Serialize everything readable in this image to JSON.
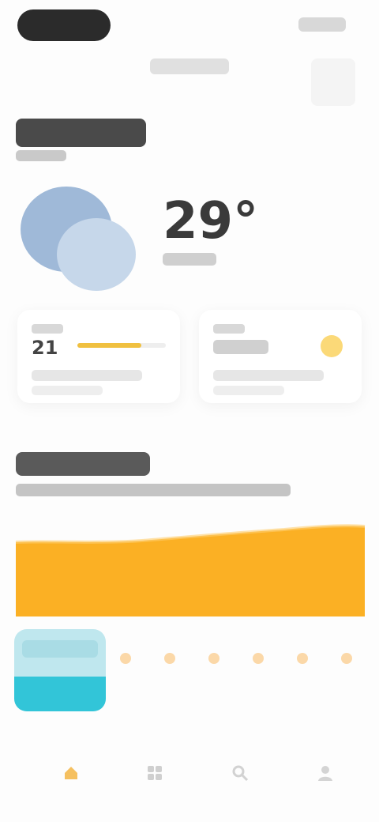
{
  "status_bar": {
    "right_text": ""
  },
  "header": {
    "center_text": "",
    "right_faint": ""
  },
  "location": {
    "title": "",
    "subtitle": ""
  },
  "current": {
    "temperature": "29°",
    "condition": "",
    "icon": "partly-cloudy-icon"
  },
  "stats": [
    {
      "label": "",
      "value": "21",
      "level": 0.72,
      "description": ""
    },
    {
      "label": "",
      "value": "",
      "description": "",
      "icon": "sun-icon"
    }
  ],
  "forecast": {
    "title": "",
    "subtitle": "",
    "days": [
      {
        "name": "",
        "selected": true
      },
      {
        "name": "",
        "selected": false
      },
      {
        "name": "",
        "selected": false
      },
      {
        "name": "",
        "selected": false
      },
      {
        "name": "",
        "selected": false
      },
      {
        "name": "",
        "selected": false
      },
      {
        "name": "",
        "selected": false
      },
      {
        "name": "",
        "selected": false
      }
    ]
  },
  "colors": {
    "accent_orange": "#fbb024",
    "accent_cyan": "#32c5d8",
    "cloud_blue": "#9fb9d8",
    "sun_yellow": "#fbd978"
  },
  "nav": [
    {
      "icon": "home-icon",
      "active": true
    },
    {
      "icon": "grid-icon",
      "active": false
    },
    {
      "icon": "search-icon",
      "active": false
    },
    {
      "icon": "profile-icon",
      "active": false
    }
  ]
}
